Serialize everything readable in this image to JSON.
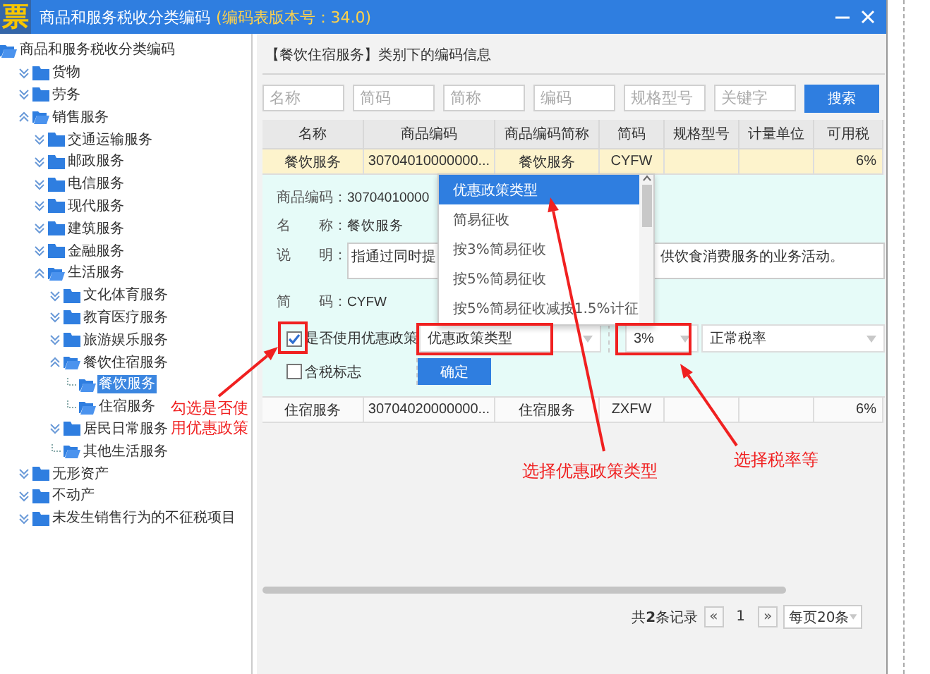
{
  "window": {
    "logo": "票",
    "title": "商品和服务税收分类编码",
    "version": "(编码表版本号：34.0)"
  },
  "tree": [
    {
      "label": "商品和服务税收分类编码",
      "kind": "root",
      "selected": false,
      "children": [
        {
          "label": "货物",
          "kind": "folder",
          "expanded": false,
          "selected": false
        },
        {
          "label": "劳务",
          "kind": "folder",
          "expanded": false,
          "selected": false
        },
        {
          "label": "销售服务",
          "kind": "folder",
          "expanded": true,
          "selected": false,
          "children": [
            {
              "label": "交通运输服务",
              "kind": "folder",
              "expanded": false,
              "selected": false
            },
            {
              "label": "邮政服务",
              "kind": "folder",
              "expanded": false,
              "selected": false
            },
            {
              "label": "电信服务",
              "kind": "folder",
              "expanded": false,
              "selected": false
            },
            {
              "label": "现代服务",
              "kind": "folder",
              "expanded": false,
              "selected": false
            },
            {
              "label": "建筑服务",
              "kind": "folder",
              "expanded": false,
              "selected": false
            },
            {
              "label": "金融服务",
              "kind": "folder",
              "expanded": false,
              "selected": false
            },
            {
              "label": "生活服务",
              "kind": "folder",
              "expanded": true,
              "selected": false,
              "children": [
                {
                  "label": "文化体育服务",
                  "kind": "folder",
                  "expanded": false,
                  "selected": false
                },
                {
                  "label": "教育医疗服务",
                  "kind": "folder",
                  "expanded": false,
                  "selected": false
                },
                {
                  "label": "旅游娱乐服务",
                  "kind": "folder",
                  "expanded": false,
                  "selected": false
                },
                {
                  "label": "餐饮住宿服务",
                  "kind": "folder",
                  "expanded": true,
                  "selected": false,
                  "children": [
                    {
                      "label": "餐饮服务",
                      "kind": "leaf",
                      "selected": true
                    },
                    {
                      "label": "住宿服务",
                      "kind": "leaf",
                      "selected": false
                    }
                  ]
                },
                {
                  "label": "居民日常服务",
                  "kind": "folder",
                  "expanded": false,
                  "selected": false
                },
                {
                  "label": "其他生活服务",
                  "kind": "leaf",
                  "selected": false
                }
              ]
            }
          ]
        },
        {
          "label": "无形资产",
          "kind": "folder",
          "expanded": false,
          "selected": false
        },
        {
          "label": "不动产",
          "kind": "folder",
          "expanded": false,
          "selected": false
        },
        {
          "label": "未发生销售行为的不征税项目",
          "kind": "folder",
          "expanded": false,
          "selected": false
        }
      ]
    }
  ],
  "panel": {
    "heading": "【餐饮住宿服务】类别下的编码信息",
    "search_fields": [
      {
        "placeholder": "名称"
      },
      {
        "placeholder": "简码"
      },
      {
        "placeholder": "简称"
      },
      {
        "placeholder": "编码"
      },
      {
        "placeholder": "规格型号"
      },
      {
        "placeholder": "关键字"
      }
    ],
    "search_button": "搜索"
  },
  "table": {
    "columns": [
      "名称",
      "商品编码",
      "商品编码简称",
      "简码",
      "规格型号",
      "计量单位",
      "可用税"
    ],
    "rows": [
      {
        "cells": [
          "餐饮服务",
          "30704010000000...",
          "餐饮服务",
          "CYFW",
          "",
          "",
          "6%"
        ],
        "selected": true
      },
      {
        "cells": [
          "住宿服务",
          "30704020000000...",
          "住宿服务",
          "ZXFW",
          "",
          "",
          "6%"
        ],
        "selected": false
      }
    ]
  },
  "detail": {
    "fields": [
      {
        "kind": "text",
        "label": "商品编码：",
        "value": "30704010000"
      },
      {
        "kind": "text",
        "label": "名　　称：",
        "value": "餐饮服务"
      },
      {
        "kind": "textarea",
        "label": "说　　明：",
        "fragments": [
          "指通过同时提",
          "供饮食消费服务的业务活动。"
        ]
      },
      {
        "kind": "text",
        "label": "简　　码：",
        "value": "CYFW"
      }
    ],
    "use_policy": {
      "label": "是否使用优惠政策",
      "checked": true
    },
    "policy_select": {
      "value": "优惠政策类型"
    },
    "rate_select": {
      "value": "3%"
    },
    "rate_type_select": {
      "value": "正常税率"
    },
    "tax_included": {
      "label": "含税标志",
      "checked": false
    },
    "confirm_button": "确定"
  },
  "dropdown": {
    "options": [
      {
        "label": "优惠政策类型",
        "selected": true
      },
      {
        "label": "简易征收",
        "selected": false
      },
      {
        "label": "按3%简易征收",
        "selected": false
      },
      {
        "label": "按5%简易征收",
        "selected": false
      },
      {
        "label": "按5%简易征收减按1.5%计征",
        "selected": false
      }
    ]
  },
  "pagination": {
    "summary": "共**2**条记录",
    "prev": "«",
    "page": "1",
    "next": "»",
    "page_size": "每页20条"
  },
  "annotations": [
    {
      "text": "勾选是否使用优惠政策"
    },
    {
      "text": "选择优惠政策类型"
    },
    {
      "text": "选择税率等"
    }
  ]
}
